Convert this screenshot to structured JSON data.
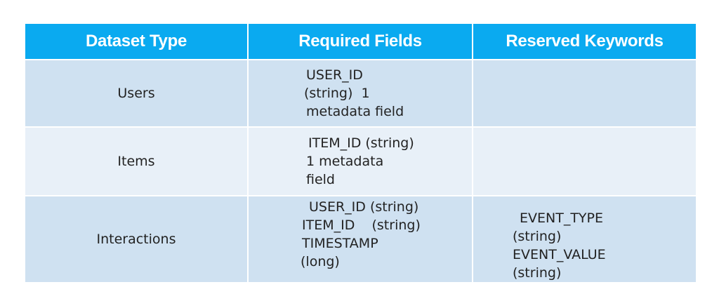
{
  "table": {
    "headers": [
      "Dataset Type",
      "Required Fields",
      "Reserved Keywords"
    ],
    "rows": [
      {
        "type": "Users",
        "required": [
          "USER_ID",
          "(string)  1",
          "metadata field"
        ],
        "reserved": []
      },
      {
        "type": "Items",
        "required": [
          "ITEM_ID (string)",
          "1 metadata",
          "field"
        ],
        "reserved": []
      },
      {
        "type": "Interactions",
        "required": [
          "USER_ID (string)",
          "ITEM_ID    (string)",
          "TIMESTAMP",
          "(long)"
        ],
        "reserved": [
          "EVENT_TYPE",
          "(string)",
          "EVENT_VALUE",
          "(string)"
        ]
      }
    ]
  },
  "colors": {
    "header_bg": "#0aaaf0",
    "row_dark": "#cfe1f1",
    "row_light": "#e8f0f8"
  }
}
